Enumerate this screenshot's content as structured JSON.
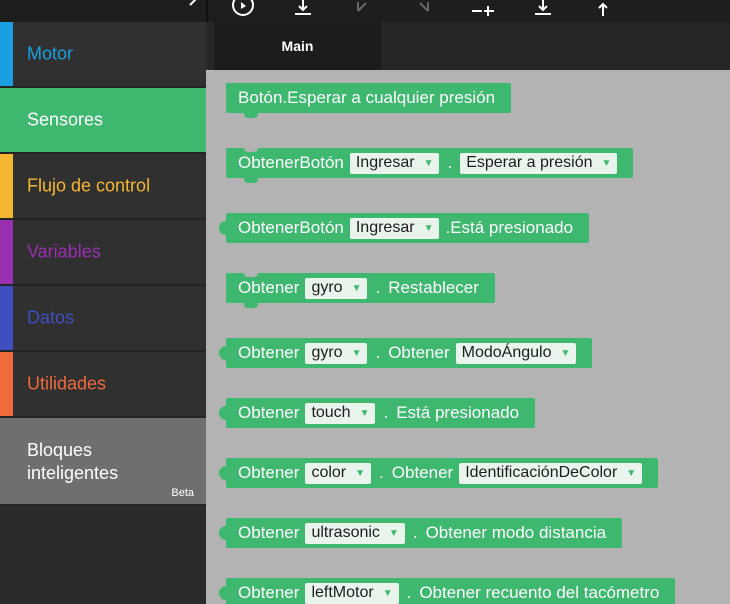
{
  "toolbar": {
    "icons": [
      "chevron-left-icon",
      "play-icon",
      "download-icon",
      "undo-icon",
      "redo-icon",
      "add-line-icon",
      "save-icon",
      "upload-icon"
    ]
  },
  "sidebar": {
    "categories": [
      {
        "label": "Motor",
        "color": "#1aa0e0",
        "text_color": "#1aa0e0"
      },
      {
        "label": "Sensores",
        "color": "#3fb86f",
        "text_color": "#ffffff",
        "active": true
      },
      {
        "label": "Flujo de control",
        "color": "#f5b731",
        "text_color": "#f5b731"
      },
      {
        "label": "Variables",
        "color": "#9a2fb0",
        "text_color": "#9a2fb0"
      },
      {
        "label": "Datos",
        "color": "#3f4fc0",
        "text_color": "#3f4fc0"
      },
      {
        "label": "Utilidades",
        "color": "#f06a3c",
        "text_color": "#f06a3c"
      }
    ],
    "smart": {
      "label_line1": "Bloques",
      "label_line2": "inteligentes",
      "badge": "Beta"
    }
  },
  "tabs": {
    "main": "Main"
  },
  "blocks": [
    {
      "text1": "Botón.Esperar a cualquier presión"
    },
    {
      "text1": "ObtenerBotón",
      "dd1": "Ingresar",
      "sep": ".",
      "dd2": "Esperar a presión"
    },
    {
      "text1": "ObtenerBotón",
      "dd1": "Ingresar",
      "text2": ".Está presionado"
    },
    {
      "text1": "Obtener",
      "dd1": "gyro",
      "sep": ".",
      "text2": "Restablecer"
    },
    {
      "text1": "Obtener",
      "dd1": "gyro",
      "sep": ".",
      "text2": "Obtener",
      "dd2": "ModoÁngulo"
    },
    {
      "text1": "Obtener",
      "dd1": "touch",
      "sep": ".",
      "text2": "Está presionado"
    },
    {
      "text1": "Obtener",
      "dd1": "color",
      "sep": ".",
      "text2": "Obtener",
      "dd2": "IdentificaciónDeColor"
    },
    {
      "text1": "Obtener",
      "dd1": "ultrasonic",
      "sep": ".",
      "text2": "Obtener modo distancia"
    },
    {
      "text1": "Obtener",
      "dd1": "leftMotor",
      "sep": ".",
      "text2": "Obtener recuento del tacómetro"
    }
  ],
  "colors": {
    "block": "#3fb86f",
    "workspace": "#b3b3b3",
    "sidebar": "#303030"
  }
}
